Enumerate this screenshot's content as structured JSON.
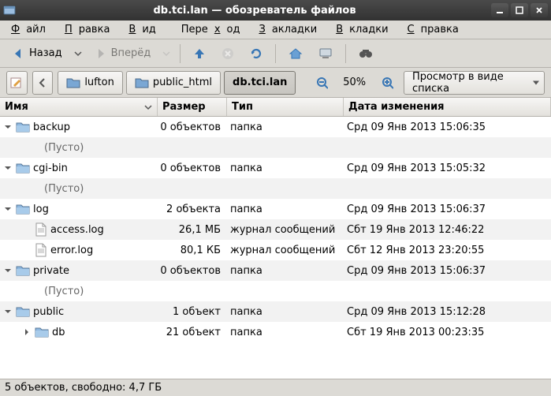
{
  "window": {
    "title": "db.tci.lan — обозреватель файлов"
  },
  "menu": {
    "file": "Файл",
    "edit": "Правка",
    "view": "Вид",
    "go": "Переход",
    "bookmarks": "Закладки",
    "tabs": "Вкладки",
    "help": "Справка"
  },
  "nav": {
    "back": "Назад",
    "forward": "Вперёд"
  },
  "breadcrumb": {
    "items": [
      "lufton",
      "public_html",
      "db.tci.lan"
    ],
    "active": 2
  },
  "zoom": {
    "label": "50%"
  },
  "viewselect": {
    "label": "Просмотр в виде списка"
  },
  "columns": {
    "name": "Имя",
    "size": "Размер",
    "type": "Тип",
    "date": "Дата изменения"
  },
  "empty_label": "(Пусто)",
  "rows": [
    {
      "kind": "folder",
      "expanded": true,
      "depth": 0,
      "name": "backup",
      "size": "0 объектов",
      "type": "папка",
      "date": "Срд 09 Янв 2013 15:06:35"
    },
    {
      "kind": "empty",
      "depth": 1
    },
    {
      "kind": "folder",
      "expanded": true,
      "depth": 0,
      "name": "cgi-bin",
      "size": "0 объектов",
      "type": "папка",
      "date": "Срд 09 Янв 2013 15:05:32"
    },
    {
      "kind": "empty",
      "depth": 1
    },
    {
      "kind": "folder",
      "expanded": true,
      "depth": 0,
      "name": "log",
      "size": "2 объекта",
      "type": "папка",
      "date": "Срд 09 Янв 2013 15:06:37"
    },
    {
      "kind": "file",
      "depth": 1,
      "name": "access.log",
      "size": "26,1 МБ",
      "type": "журнал сообщений",
      "date": "Сбт 19 Янв 2013 12:46:22"
    },
    {
      "kind": "file",
      "depth": 1,
      "name": "error.log",
      "size": "80,1 КБ",
      "type": "журнал сообщений",
      "date": "Сбт 12 Янв 2013 23:20:55"
    },
    {
      "kind": "folder",
      "expanded": true,
      "depth": 0,
      "name": "private",
      "size": "0 объектов",
      "type": "папка",
      "date": "Срд 09 Янв 2013 15:06:37"
    },
    {
      "kind": "empty",
      "depth": 1
    },
    {
      "kind": "folder",
      "expanded": true,
      "depth": 0,
      "name": "public",
      "size": "1 объект",
      "type": "папка",
      "date": "Срд 09 Янв 2013 15:12:28"
    },
    {
      "kind": "folder",
      "expanded": false,
      "depth": 1,
      "name": "db",
      "size": "21 объект",
      "type": "папка",
      "date": "Сбт 19 Янв 2013 00:23:35"
    }
  ],
  "status": {
    "text": "5 объектов, свободно: 4,7 ГБ"
  }
}
